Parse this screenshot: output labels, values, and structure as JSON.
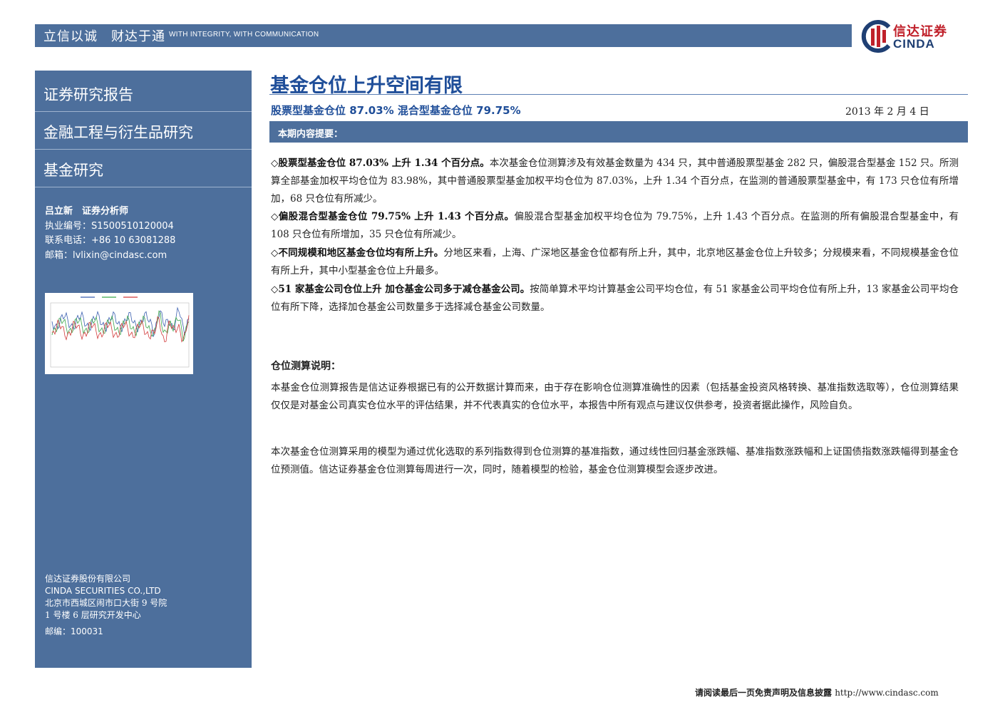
{
  "header": {
    "slogan_cn": "立信以诚　财达于通",
    "slogan_en": "WITH INTEGRITY, WITH COMMUNICATION",
    "logo_cn": "信达证券",
    "logo_en": "CINDA"
  },
  "sidebar": {
    "sections": [
      "证券研究报告",
      "金融工程与衍生品研究",
      "基金研究"
    ],
    "analyst": {
      "name_title": "吕立新　证券分析师",
      "license": "执业编号：S1500510120004",
      "phone": "联系电话：+86 10 63081288",
      "email": "邮箱：lvlixin@cindasc.com"
    },
    "company": {
      "name_cn": "信达证券股份有限公司",
      "name_en": "CINDA SECURITIES CO.,LTD",
      "address1": "北京市西城区闹市口大街 9 号院",
      "address2": "1 号楼 6 层研究开发中心",
      "postcode": "邮编：100031"
    }
  },
  "main": {
    "title": "基金仓位上升空间有限",
    "subtitle": "股票型基金仓位 87.03% 混合型基金仓位 79.75%",
    "date": "2013 年 2 月 4 日",
    "summary_label": "本期内容提要：",
    "points": [
      {
        "head": "◇股票型基金仓位 87.03% 上升 1.34 个百分点。",
        "body": "本次基金仓位测算涉及有效基金数量为 434 只，其中普通股票型基金 282 只，偏股混合型基金 152 只。所测算全部基金加权平均仓位为 83.98%，其中普通股票型基金加权平均仓位为 87.03%，上升 1.34 个百分点，在监测的普通股票型基金中，有 173 只仓位有所增加，68 只仓位有所减少。"
      },
      {
        "head": "◇偏股混合型基金仓位 79.75% 上升 1.43 个百分点。",
        "body": "偏股混合型基金加权平均仓位为 79.75%，上升 1.43 个百分点。在监测的所有偏股混合型基金中，有 108 只仓位有所增加，35 只仓位有所减少。"
      },
      {
        "head": "◇不同规模和地区基金仓位均有所上升。",
        "body": "分地区来看，上海、广深地区基金仓位都有所上升，其中，北京地区基金仓位上升较多；分规模来看，不同规模基金仓位有所上升，其中小型基金仓位上升最多。"
      },
      {
        "head": "◇51 家基金公司仓位上升 加仓基金公司多于减仓基金公司。",
        "body": "按简单算术平均计算基金公司平均仓位，有 51 家基金公司平均仓位有所上升，13 家基金公司平均仓位有所下降，选择加仓基金公司数量多于选择减仓基金公司数量。"
      }
    ],
    "method_head": "仓位测算说明：",
    "method_paragraphs": [
      "本基金仓位测算报告是信达证券根据已有的公开数据计算而来，由于存在影响仓位测算准确性的因素（包括基金投资风格转换、基准指数选取等），仓位测算结果仅仅是对基金公司真实仓位水平的评估结果，并不代表真实的仓位水平，本报告中所有观点与建议仅供参考，投资者据此操作，风险自负。",
      "本次基金仓位测算采用的模型为通过优化选取的系列指数得到仓位测算的基准指数，通过线性回归基金涨跌幅、基准指数涨跌幅和上证国债指数涨跌幅得到基金仓位预测值。信达证券基金仓位测算每周进行一次，同时，随着模型的检验，基金仓位测算模型会逐步改进。"
    ]
  },
  "footer": {
    "notice": "请阅读最后一页免责声明及信息披露 ",
    "url": "http://www.cindasc.com"
  },
  "colors": {
    "brand_blue": "#4d6f9c",
    "title_blue": "#1f4e99",
    "logo_red": "#c0202a",
    "thumb_series": [
      "#3a5fb0",
      "#3aa64a",
      "#d23a3a",
      "#e0b020"
    ]
  }
}
